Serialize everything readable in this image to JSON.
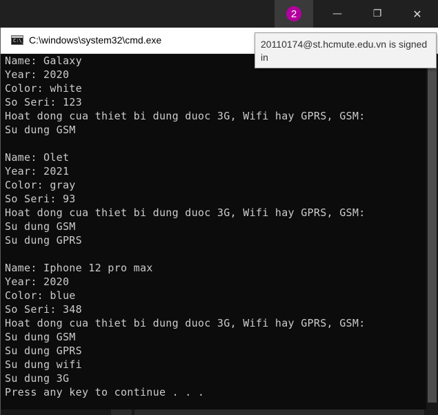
{
  "host": {
    "notification_count": "2",
    "minimize_glyph": "—",
    "maximize_glyph": "❐",
    "close_glyph": "✕"
  },
  "cmd": {
    "title": "C:\\windows\\system32\\cmd.exe",
    "icon_text": "C:\\_"
  },
  "tooltip": {
    "text": "20110174@st.hcmute.edu.vn is signed in"
  },
  "console": {
    "lines": [
      "Name: Galaxy",
      "Year: 2020",
      "Color: white",
      "So Seri: 123",
      "Hoat dong cua thiet bi dung duoc 3G, Wifi hay GPRS, GSM:",
      "Su dung GSM",
      "",
      "Name: Olet",
      "Year: 2021",
      "Color: gray",
      "So Seri: 93",
      "Hoat dong cua thiet bi dung duoc 3G, Wifi hay GPRS, GSM:",
      "Su dung GSM",
      "Su dung GPRS",
      "",
      "Name: Iphone 12 pro max",
      "Year: 2020",
      "Color: blue",
      "So Seri: 348",
      "Hoat dong cua thiet bi dung duoc 3G, Wifi hay GPRS, GSM:",
      "Su dung GSM",
      "Su dung GPRS",
      "Su dung wifi",
      "Su dung 3G",
      "Press any key to continue . . ."
    ]
  },
  "colors": {
    "console_bg": "#0c0c0c",
    "console_fg": "#cccccc",
    "badge": "#b4009e"
  }
}
